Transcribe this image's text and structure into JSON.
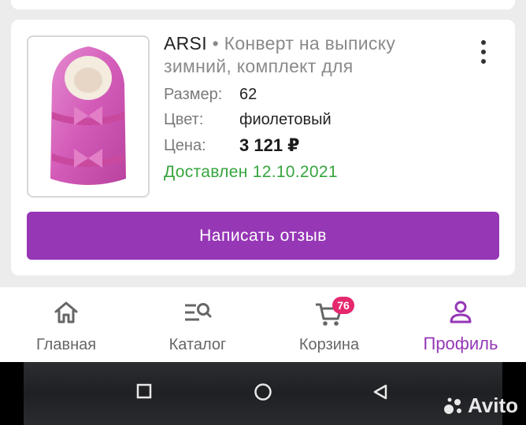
{
  "order": {
    "brand": "ARSI",
    "separator": " • ",
    "title": "Конверт на выписку зимний, комплект для",
    "size_label": "Размер:",
    "size_value": "62",
    "color_label": "Цвет:",
    "color_value": "фиолетовый",
    "price_label": "Цена:",
    "price_value": "3 121 ₽",
    "status": "Доставлен 12.10.2021",
    "review_button": "Написать отзыв"
  },
  "bottom_nav": {
    "items": [
      {
        "label": "Главная",
        "icon": "home-icon"
      },
      {
        "label": "Каталог",
        "icon": "catalog-search-icon"
      },
      {
        "label": "Корзина",
        "icon": "cart-icon",
        "badge": "76"
      },
      {
        "label": "Профиль",
        "icon": "profile-icon",
        "active": true
      }
    ]
  },
  "system_nav": {
    "buttons": [
      "recents-square-icon",
      "home-circle-icon",
      "back-triangle-icon"
    ]
  },
  "watermark": {
    "text": "Avito"
  },
  "colors": {
    "accent": "#9637b6",
    "delivered": "#36a53e",
    "badge": "#e6286e",
    "background": "#ececec"
  }
}
